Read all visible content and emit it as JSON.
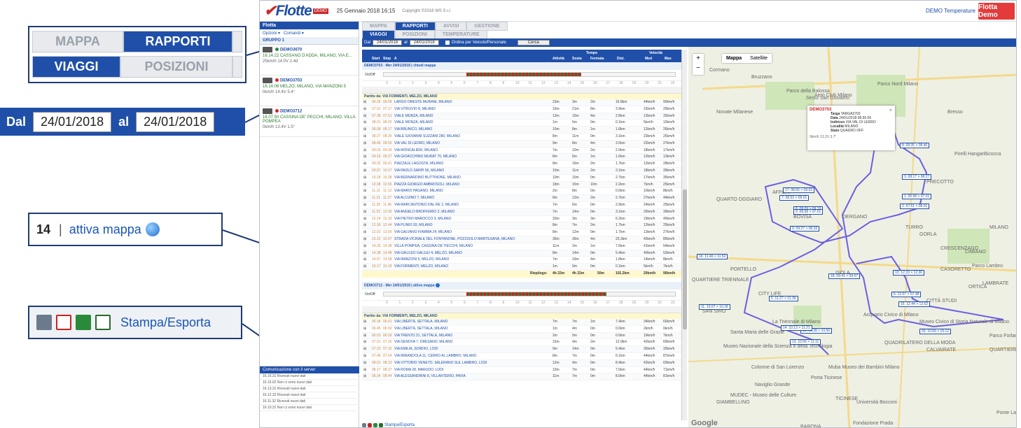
{
  "callouts": {
    "tabs_row1": {
      "mappa": "MAPPA",
      "rapporti": "RAPPORTI"
    },
    "tabs_row2": {
      "viaggi": "VIAGGI",
      "posizioni": "POSIZIONI"
    },
    "date": {
      "dal_label": "Dal",
      "dal_value": "24/01/2018",
      "al_label": "al",
      "al_value": "24/01/2018"
    },
    "map_link": {
      "num": "14",
      "sep": "|",
      "link": "attiva mappa"
    },
    "export": {
      "link": "Stampa/Esporta"
    }
  },
  "app": {
    "logo": "Flotte",
    "logo_tag": "DEMO",
    "date": "25 Gennaio 2018 16:15",
    "copyright": "Copyright ©2018 WS S.r.l.",
    "user_menu": "DEMO Temperature",
    "badge": "Flotta Demo"
  },
  "sidebar": {
    "header": "Flotta",
    "options": "Opzioni",
    "commands": "Comandi",
    "group": "GRUPPO 1",
    "vehicles": [
      {
        "name": "DEMO3670",
        "addr": "16.14.22 CASSANO D'ADDA, MILANO, VIA E...",
        "stat": "25km/h  14.0V  2.4d"
      },
      {
        "name": "DEMO3703",
        "addr": "16.14.06 MELZO, MILANO, VIA MANZONI 5",
        "stat": "0km/h  14.4V  5.4°"
      },
      {
        "name": "DEMO3712",
        "addr": "16.07.50 CASSINA DE' PECCHI, MILANO, VILLA POMPEA",
        "stat": "0km/h  13.4V  1.5°"
      }
    ],
    "server_header": "Comunicazione con il server",
    "server_log": [
      "16.15.31 Ricevuti nuovi dati",
      "16.15.02 Non ci sono nuovi dati",
      "16.13.31 Ricevuti nuovi dati",
      "16.12.32 Ricevuti nuovi dati",
      "16.11.32 Ricevuti nuovi dati",
      "16.10.31 Non ci sono nuovi dati"
    ]
  },
  "tabs": {
    "top": [
      "MAPPA",
      "RAPPORTI",
      "AVVISI",
      "GESTIONE"
    ],
    "sub": [
      "VIAGGI",
      "POSIZIONI",
      "TEMPERATURE"
    ]
  },
  "filter": {
    "dal": "Dal",
    "from": "24/01/2018",
    "al": "al",
    "to": "24/01/2018",
    "checkbox": "Ordina per Veicolo/Personale",
    "button": "Cerca"
  },
  "table": {
    "headers": {
      "start": "Start",
      "stop": "Stop",
      "addr": "A",
      "tempo": "Tempo",
      "attivita": "Attività",
      "sosta": "Sosta",
      "fermata": "Fermata",
      "dist": "Dist.",
      "velocita": "Velocità",
      "med": "Med",
      "max": "Max"
    },
    "trip1": {
      "title": "DEMO3703 - Mer 24/01/2018",
      "link": "chiudi mappa",
      "onoff": "On/Off",
      "partito": "Partito da: VIA FORMENTI, MELZO, MILANO",
      "rows": [
        [
          "06.35",
          "06.58",
          "LARGO ORESTE MURANI, MILANO",
          "23m",
          "3m",
          "2m",
          "16.8km",
          "44km/h",
          "90km/h"
        ],
        [
          "07.01",
          "07.17",
          "VIA VITRUVIO 8, MILANO",
          "16m",
          "21m",
          "8m",
          "3.9km",
          "15km/h",
          "29km/h"
        ],
        [
          "07.38",
          "07.51",
          "VIALE MONZA, MILANO",
          "13m",
          "10m",
          "4m",
          "2.8km",
          "13km/h",
          "32km/h"
        ],
        [
          "08.01",
          "08.02",
          "VIALE MONZA, MILANO",
          "1m",
          "5m",
          "0m",
          "0.1km",
          "5km/h",
          "10km/h"
        ],
        [
          "08.08",
          "08.17",
          "VIA BRUNICO, MILANO",
          "10m",
          "8m",
          "1m",
          "1.8km",
          "12km/h",
          "26km/h"
        ],
        [
          "08.27",
          "08.35",
          "VIALE GIOVANNI SUZZANI 280, MILANO",
          "8m",
          "11m",
          "0m",
          "3.1km",
          "23km/h",
          "25km/h"
        ],
        [
          "08.46",
          "08.55",
          "VIA VAL DI LEDRO, MILANO",
          "9m",
          "8m",
          "4m",
          "3.5km",
          "22km/h",
          "27km/h"
        ],
        [
          "09.03",
          "09.09",
          "VIA MONCALIERI, MILANO",
          "7m",
          "10m",
          "2m",
          "2.0km",
          "18km/h",
          "17km/h"
        ],
        [
          "09.19",
          "09.27",
          "VIA GIOACCHINO MURAT 70, MILANO",
          "8m",
          "5m",
          "1m",
          "1.6km",
          "12km/h",
          "13km/h"
        ],
        [
          "09.32",
          "09.41",
          "PIAZZALE LAGOSTA, MILANO",
          "8m",
          "16m",
          "2m",
          "1.7km",
          "12km/h",
          "28km/h"
        ],
        [
          "09.57",
          "10.07",
          "VIA PAOLO SARPI 56, MILANO",
          "10m",
          "11m",
          "2m",
          "3.1km",
          "18km/h",
          "39km/h"
        ],
        [
          "10.18",
          "10.28",
          "VIA BERNARDINO BUTTINONE, MILANO",
          "10m",
          "10m",
          "0m",
          "2.7km",
          "17km/h",
          "35km/h"
        ],
        [
          "10.38",
          "10.56",
          "PIAZZA GIORGIO AMBROSOLI, MILANO",
          "18m",
          "15m",
          "10m",
          "2.2km",
          "7km/h",
          "25km/h"
        ],
        [
          "11.11",
          "11.13",
          "VIA MARIO PAGANO, MILANO",
          "2m",
          "8m",
          "0m",
          "0.6km",
          "10km/h",
          "8km/h"
        ],
        [
          "11.21",
          "11.27",
          "VIA ALCUINO 7, MILANO",
          "8m",
          "12m",
          "2m",
          "2.7km",
          "27km/h",
          "44km/h"
        ],
        [
          "11.39",
          "11.46",
          "VIA MARCANTONIO DAL RE 2, MILANO",
          "7m",
          "6m",
          "0m",
          "2.9km",
          "24km/h",
          "25km/h"
        ],
        [
          "11.52",
          "12.00",
          "VIA ANGELO BROFFERIO 2, MILANO",
          "7m",
          "14m",
          "0m",
          "3.1km",
          "25km/h",
          "39km/h"
        ],
        [
          "12.14",
          "12.33",
          "VIA PIETRO MAROCCO 3, MILANO",
          "20m",
          "3m",
          "3m",
          "6.2km",
          "19km/h",
          "40km/h"
        ],
        [
          "12.36",
          "12.44",
          "VIA PLINIO 93, MILANO",
          "8m",
          "7m",
          "2m",
          "1.7km",
          "12km/h",
          "25km/h"
        ],
        [
          "12.52",
          "13.00",
          "VIA GALVANO FIAMMA 24, MILANO",
          "8m",
          "12m",
          "0m",
          "1.7km",
          "13km/h",
          "27km/h"
        ],
        [
          "13.12",
          "13.47",
          "STRADA VICINALE DEL FONTANONE, POZZUOLO MARTESANA, MILANO",
          "35m",
          "39m",
          "4m",
          "23.3km",
          "40km/h",
          "85km/h"
        ],
        [
          "14.26",
          "14.38",
          "VILLA POMPEA, CASSINA DE' PECCHI, MILANO",
          "11m",
          "2m",
          "1m",
          "7.6km",
          "41km/h",
          "54km/h"
        ],
        [
          "14.38",
          "14.48",
          "VIA GALILEO GALILEI 4, MELZO, MILANO",
          "8m",
          "14m",
          "0m",
          "5.4km",
          "40km/h",
          "53km/h"
        ],
        [
          "14.57",
          "14.58",
          "VIA MANZONI 5, MELZO, MILANO",
          "7m",
          "19m",
          "4m",
          "1.8km",
          "14km/h",
          "8km/h"
        ],
        [
          "15.17",
          "15.18",
          "VIA FORMENTI, MELZO, MILANO",
          "1m",
          "0m",
          "0m",
          "0.1km",
          "5km/h",
          "7km/h"
        ]
      ],
      "summary": [
        "Riepilogo:",
        "4h 22m",
        "4h 22m",
        "50m",
        "102.2km",
        "20km/h",
        "90km/h"
      ]
    },
    "trip2": {
      "title": "DEMO3712 - Mer 24/01/2018",
      "link": "attiva mappa",
      "onoff": "On/Off",
      "partito": "Partito da: VIA FORMENTI, MELZO, MILANO",
      "rows": [
        [
          "06.34",
          "06.41",
          "VIA LIBERTÀ, SETTALA, MILANO",
          "7m",
          "7m",
          "1m",
          "7.4km",
          "34km/h",
          "60km/h"
        ],
        [
          "06.45",
          "06.50",
          "VIA LIBERTÀ, SETTALA, MILANO",
          "1m",
          "4m",
          "0m",
          "0.0km",
          "2km/h",
          "0km/h"
        ],
        [
          "06.53",
          "06.58",
          "VIA TRENTO 31, SETTALA, MILANO",
          "2m",
          "5m",
          "0m",
          "0.6km",
          "19km/h",
          "7km/h"
        ],
        [
          "07.01",
          "07.16",
          "VIA GENOVA 7, DRESANO, MILANO",
          "15m",
          "4m",
          "2m",
          "12.9km",
          "42km/h",
          "69km/h"
        ],
        [
          "07.23",
          "07.32",
          "VIA EMILIA, SORDIO, LODI",
          "9m",
          "14m",
          "0m",
          "5.4km",
          "35km/h",
          "33km/h"
        ],
        [
          "07.46",
          "07.54",
          "VIA MIRANDOLA 11, CERRO AL LAMBRO, MILANO",
          "8m",
          "7m",
          "0m",
          "6.1km",
          "44km/h",
          "87km/h"
        ],
        [
          "08.01",
          "08.13",
          "VIA VITTORIO VENETO, SALERANO SUL LAMBRO, LODI",
          "12m",
          "4m",
          "0m",
          "8.4km",
          "42km/h",
          "60km/h"
        ],
        [
          "08.17",
          "08.27",
          "VIA ROMA 28, MARUDO, LODI",
          "10m",
          "7m",
          "0m",
          "7.5km",
          "44km/h",
          "71km/h"
        ],
        [
          "08.34",
          "08.44",
          "VIA ALESSANDRINI 8, VILLANTERIO, PAVIA",
          "11m",
          "7m",
          "0m",
          "8.0km",
          "44km/h",
          "81km/h"
        ]
      ]
    },
    "ticks": [
      "0",
      "1",
      "2",
      "3",
      "4",
      "5",
      "6",
      "7",
      "8",
      "9",
      "10",
      "11",
      "12",
      "13",
      "14",
      "15",
      "16",
      "17",
      "18",
      "19",
      "20",
      "21",
      "22"
    ],
    "export": "Stampa/Esporta"
  },
  "map": {
    "type_map": "Mappa",
    "type_sat": "Satellite",
    "popup": {
      "title": "DEMO3703",
      "targa_k": "Targa",
      "targa_v": "TARGA3703",
      "data_k": "Data",
      "data_v": "24/01/2018 08.55.06",
      "ind_k": "Indirizzo",
      "ind_v": "VIA VAL DI LEDRO",
      "loc_k": "Località",
      "loc_v": "MILANO",
      "stato_k": "Stato",
      "stato_v": "QUADRO OFF",
      "foot": "0km/h  13.2V  3.7°"
    },
    "places": [
      "Sesto San Giovanni",
      "Bresso",
      "Parco Nord Milano",
      "Parco della Balossa",
      "Aero Club Milano",
      "Novate Milanese",
      "Pirelli HangarBicocca",
      "PRECOTTO",
      "AFFORI",
      "QUARTO OGGIARO",
      "BOVISA",
      "DERGANO",
      "GORLA",
      "CRESCENZAGO",
      "TURRO",
      "MILANO",
      "CIMIANO",
      "Parco Lambro",
      "QUARTIERE TRIENNALE",
      "CITY LIFE",
      "SAN SIRO",
      "PORTELLO",
      "ISOLA",
      "CASORETTO",
      "LAMBRATE",
      "CITTÀ STUDI",
      "Acquario Civico di Milano",
      "Museo Civico di Storia Naturale di Milano",
      "La Triennale di Milano",
      "Santa Maria delle Grazie",
      "Museo Nazionale della Scienza e della Tecnologia",
      "Colonne di San Lorenzo",
      "Muba Museo dei Bambini Milano",
      "TICINESE",
      "MUDEC - Museo delle Culture",
      "Porta Ticinese",
      "Naviglio Grande",
      "GIAMBELLINO",
      "Università Bocconi",
      "Fondazione Prada",
      "BARONA",
      "QUARTIERE FORLANINI",
      "CALVAIRATE",
      "Ponte Lambro",
      "Parco Forlanini",
      "ORTICA",
      "QUADRILATERO DELLA MODA",
      "Cormano",
      "Bruzzano"
    ],
    "labels": [
      "8. 08.35 > 08.46",
      "17. 08.55 > 09.03",
      "8. 08.09 > 09.19",
      "7. 08.53 > 09.01",
      "9. 09.27 > 09.32",
      "16. 11.46 > 11.52",
      "18. 09.41 > 09.57",
      "10. 12.33 > 12.36",
      "11. 10.07 > 10.18",
      "12. 10.38 > 10.56",
      "13. 10.56 > 11.11",
      "14. 10.13 > 11.21",
      "15. 12.44 > 12.52",
      "20. 10.56 > 15.12",
      "3. 08.17 > 08.27",
      "2. 07.51 > 08.01",
      "1. 06.58 > 07.01",
      "5. 11.27 > 11.39",
      "6. 12.07 > 07.38",
      "9. 08.58 > 07.01"
    ],
    "google": "Google"
  }
}
